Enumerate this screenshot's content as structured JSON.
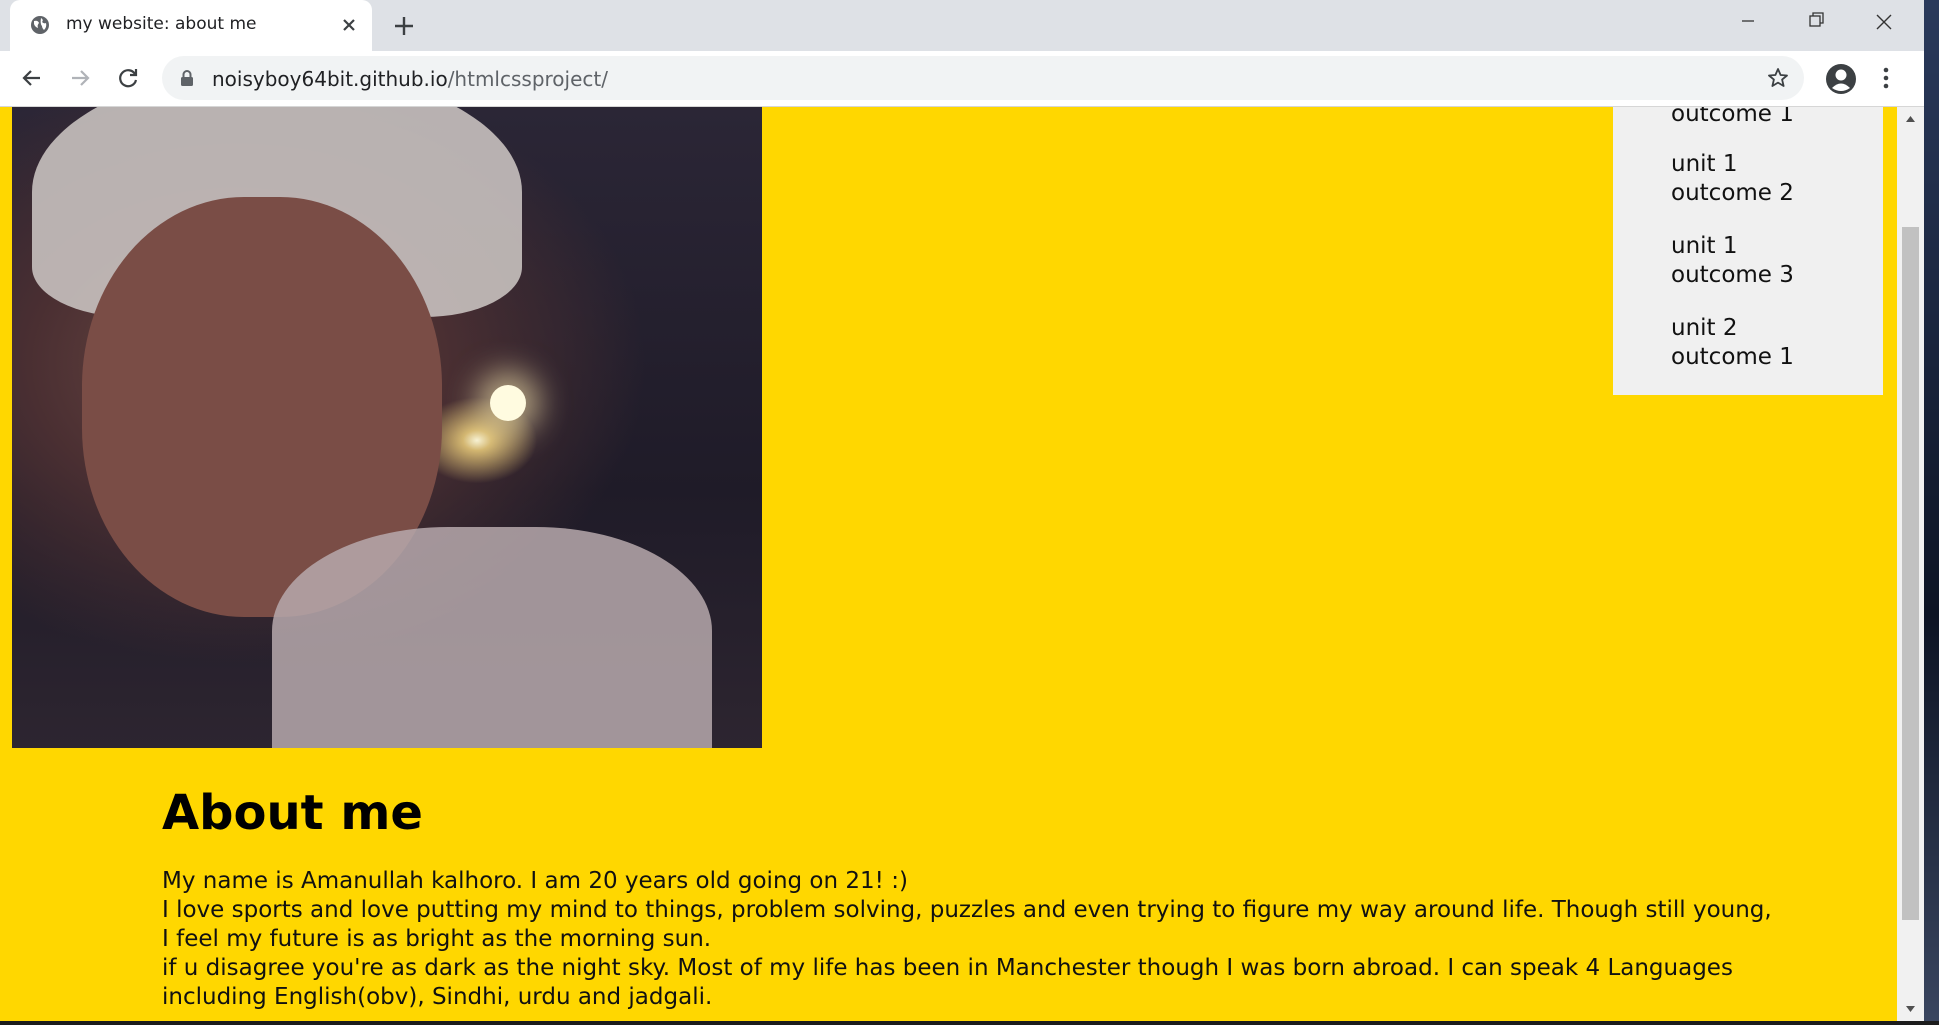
{
  "browser": {
    "tab_title": "my website: about me",
    "url_host": "noisyboy64bit.github.io",
    "url_path": "/htmlcssproject/"
  },
  "sidenav": {
    "items": [
      {
        "label_line1": "outcome 1",
        "label_line2": ""
      },
      {
        "label_line1": "unit 1",
        "label_line2": "outcome 2"
      },
      {
        "label_line1": "unit 1",
        "label_line2": "outcome 3"
      },
      {
        "label_line1": "unit 2",
        "label_line2": "outcome 1"
      }
    ]
  },
  "main": {
    "heading": "About me",
    "bio_lines": [
      "My name is Amanullah kalhoro. I am 20 years old going on 21! :)",
      "I love sports and love putting my mind to things, problem solving, puzzles and even trying to figure my way around life. Though still young,",
      "I feel my future is as bright as the morning sun.",
      "if u disagree you're as dark as the night sky. Most of my life has been in Manchester though I was born abroad. I can speak 4 Languages",
      "including English(obv), Sindhi, urdu and jadgali."
    ]
  },
  "colors": {
    "page_background": "#ffd700",
    "sidenav_background": "#f0f0f0"
  }
}
